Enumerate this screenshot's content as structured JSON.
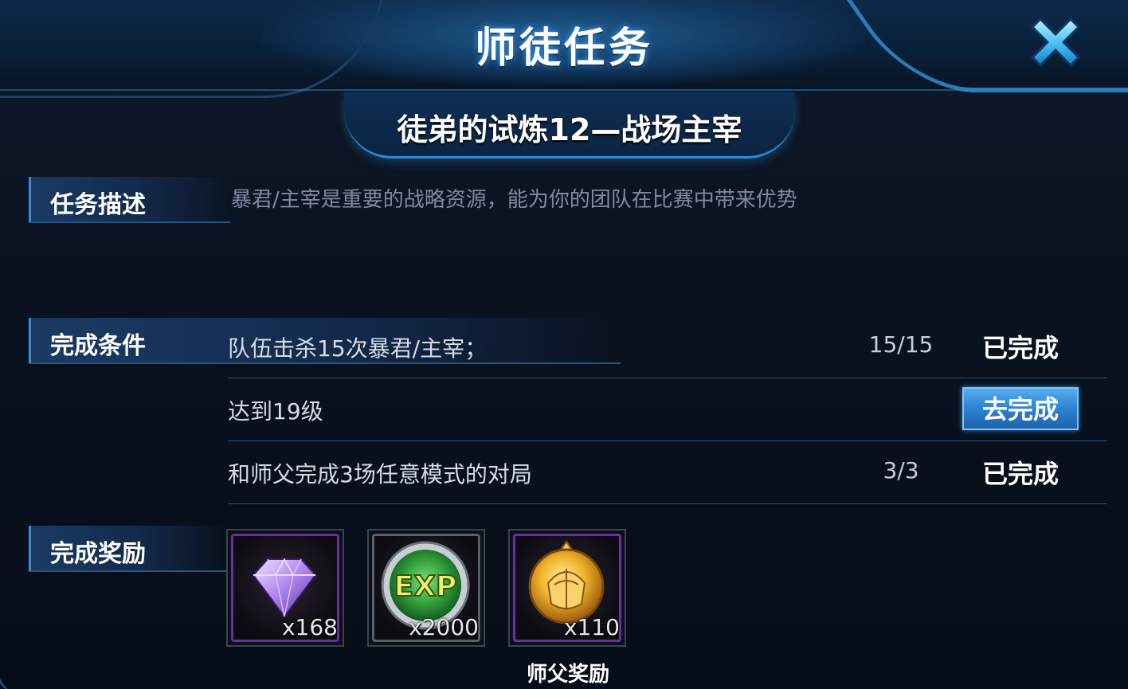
{
  "header": {
    "title": "师徒任务",
    "close_icon": "close-x-icon"
  },
  "task": {
    "subtitle": "徒弟的试炼12—战场主宰"
  },
  "description": {
    "label": "任务描述",
    "text": "暴君/主宰是重要的战略资源，能为你的团队在比赛中带来优势"
  },
  "conditions": {
    "label": "完成条件",
    "rows": [
      {
        "text": "队伍击杀15次暴君/主宰；",
        "progress": "15/15",
        "status": "已完成"
      },
      {
        "text": "达到19级",
        "progress": "",
        "button": "去完成"
      },
      {
        "text": "和师父完成3场任意模式的对局",
        "progress": "3/3",
        "status": "已完成"
      }
    ]
  },
  "rewards": {
    "label": "完成奖励",
    "items": [
      {
        "icon": "purple-diamond-icon",
        "count": "x168"
      },
      {
        "icon": "exp-badge-icon",
        "count": "x2000"
      },
      {
        "icon": "gold-medal-icon",
        "count": "x110"
      }
    ],
    "master_reward_label": "师父奖励"
  },
  "colors": {
    "accent_blue": "#2d8fd0",
    "button_blue": "#2f86d4",
    "purple_frame": "#6a2fa2",
    "muted_text": "#7d8aa0"
  }
}
